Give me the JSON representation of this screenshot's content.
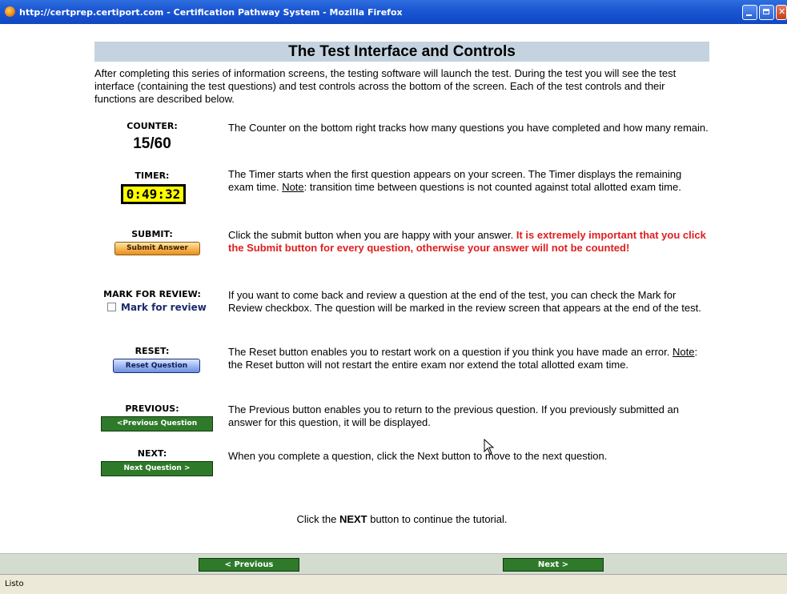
{
  "window": {
    "title": "http://certprep.certiport.com - Certification Pathway System - Mozilla Firefox",
    "icon": "firefox-icon"
  },
  "page": {
    "heading": "The Test Interface and Controls",
    "intro": "After completing this series of information screens, the testing software will launch the test. During the test you will see the test interface (containing the test questions) and test controls across the bottom of the screen. Each of the test controls and their functions are described below."
  },
  "controls": {
    "counter": {
      "label": "COUNTER:",
      "value": "15/60",
      "desc": "The Counter on the bottom right tracks how many questions you have completed and how many remain."
    },
    "timer": {
      "label": "TIMER:",
      "value": "0:49:32",
      "desc_1": "The Timer starts when the first question appears on your screen. The Timer displays the remaining exam time. ",
      "note_label": "Note",
      "desc_2": ": transition time between questions is not counted against total allotted exam time."
    },
    "submit": {
      "label": "SUBMIT:",
      "button": "Submit Answer",
      "desc": "Click the submit button when you are happy with your answer. ",
      "warning": "It is extremely important that you click the Submit button for every question, otherwise your answer will not be counted!"
    },
    "mark_for_review": {
      "label": "MARK FOR REVIEW:",
      "checkbox_label": "Mark for review",
      "checked": false,
      "desc": "If you want to come back and review a question at the end of the test, you can check the Mark for Review checkbox. The question will be marked in the review screen that appears at the end of the test."
    },
    "reset": {
      "label": "RESET:",
      "button": "Reset Question",
      "desc_1": "The Reset button enables you to restart work on a question if you think you have made an error. ",
      "note_label": "Note",
      "desc_2": ": the Reset button will not restart the entire exam nor extend the total allotted exam time."
    },
    "previous": {
      "label": "PREVIOUS:",
      "button": "<Previous Question",
      "desc": "The Previous button enables you to return to the previous question. If you previously submitted an answer for this question, it will be displayed."
    },
    "next": {
      "label": "NEXT:",
      "button": "Next Question >",
      "desc": "When you complete a question, click the Next button to move to the next question."
    }
  },
  "footer": {
    "pre": "Click the ",
    "bold": "NEXT",
    "post": " button to continue the tutorial."
  },
  "nav": {
    "previous": "< Previous",
    "next": "Next >"
  },
  "status": {
    "text": "Listo"
  },
  "colors": {
    "titlebar": "#1c58d3",
    "heading_bg": "#c4d3df",
    "timer_bg": "#ffff00",
    "warning": "#e01e1e",
    "nav_green": "#2f7a2a",
    "navbar_bg": "#d3dccf"
  }
}
